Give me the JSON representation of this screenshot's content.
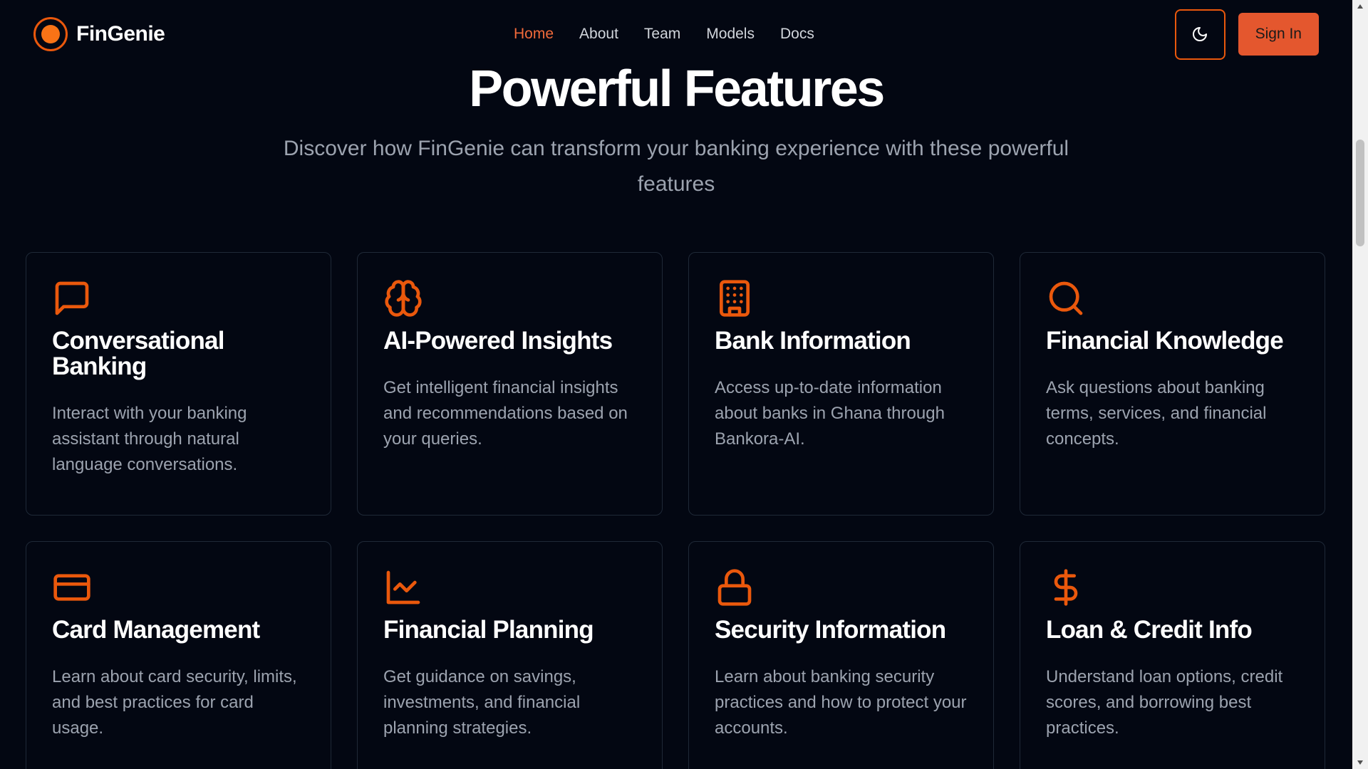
{
  "brand": {
    "name": "FinGenie"
  },
  "nav": {
    "items": [
      {
        "label": "Home",
        "active": true
      },
      {
        "label": "About",
        "active": false
      },
      {
        "label": "Team",
        "active": false
      },
      {
        "label": "Models",
        "active": false
      },
      {
        "label": "Docs",
        "active": false
      }
    ]
  },
  "header": {
    "theme_toggle_icon": "moon-icon",
    "signin_label": "Sign In"
  },
  "hero": {
    "title": "Powerful Features",
    "subtitle": "Discover how FinGenie can transform your banking experience with these powerful features"
  },
  "features": [
    {
      "icon": "chat-bubble-icon",
      "title": "Conversational Banking",
      "description": "Interact with your banking assistant through natural language conversations."
    },
    {
      "icon": "brain-icon",
      "title": "AI-Powered Insights",
      "description": "Get intelligent financial insights and recommendations based on your queries."
    },
    {
      "icon": "building-icon",
      "title": "Bank Information",
      "description": "Access up-to-date information about banks in Ghana through Bankora-AI."
    },
    {
      "icon": "search-icon",
      "title": "Financial Knowledge",
      "description": "Ask questions about banking terms, services, and financial concepts."
    },
    {
      "icon": "credit-card-icon",
      "title": "Card Management",
      "description": "Learn about card security, limits, and best practices for card usage."
    },
    {
      "icon": "line-chart-icon",
      "title": "Financial Planning",
      "description": "Get guidance on savings, investments, and financial planning strategies."
    },
    {
      "icon": "lock-icon",
      "title": "Security Information",
      "description": "Learn about banking security practices and how to protect your accounts."
    },
    {
      "icon": "dollar-sign-icon",
      "title": "Loan & Credit Info",
      "description": "Understand loan options, credit scores, and borrowing best practices."
    }
  ],
  "colors": {
    "background": "#030712",
    "accent": "#ea580c",
    "nav_active": "#f26a3a",
    "button": "#e4572e",
    "card_border": "#1f2937",
    "muted_text": "#9ca3af"
  }
}
